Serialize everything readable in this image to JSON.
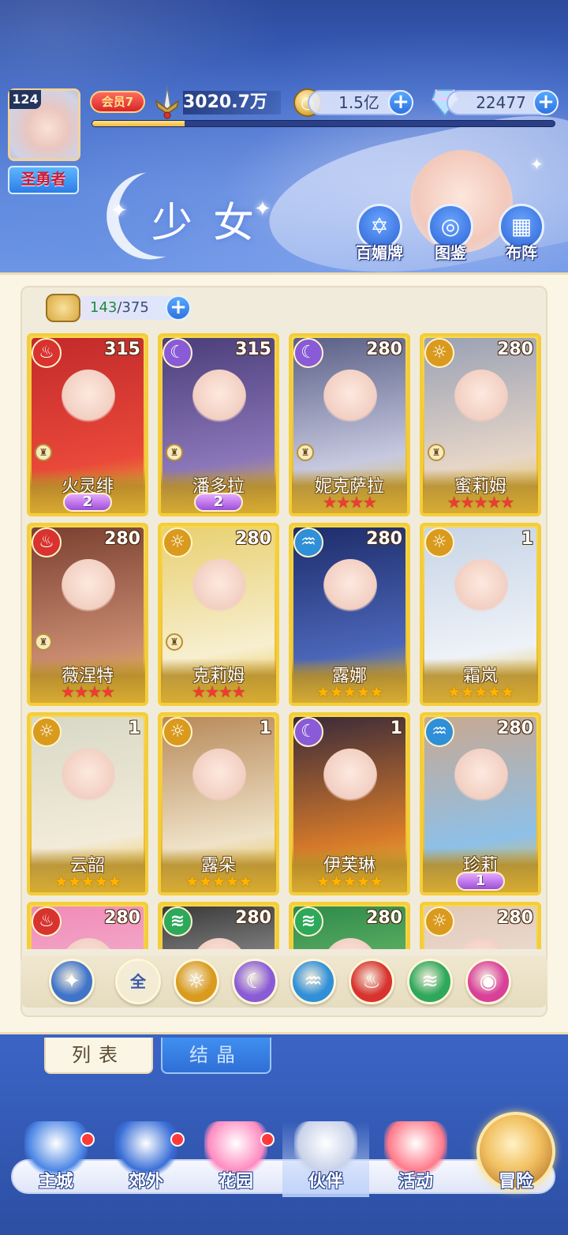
{
  "header": {
    "title": "少女",
    "player_level": "124",
    "rank": "圣勇者",
    "vip": "会员7",
    "power": "3020.7万",
    "exp_progress": 0.2,
    "gold": "1.5亿",
    "gems": "22477",
    "top_buttons": [
      {
        "label": "百媚牌",
        "icon": "card-deck-icon"
      },
      {
        "label": "图鉴",
        "icon": "book-icon"
      },
      {
        "label": "布阵",
        "icon": "grid-formation-icon"
      }
    ]
  },
  "collection": {
    "owned": "143",
    "total": "/375"
  },
  "cards": [
    {
      "name": "火灵绯",
      "level": "315",
      "element": "fire",
      "stars": "",
      "star_color": "",
      "wings": "2",
      "tower": true,
      "art": [
        "#c22a2a",
        "#e9483a"
      ]
    },
    {
      "name": "潘多拉",
      "level": "315",
      "element": "moon",
      "stars": "",
      "star_color": "",
      "wings": "2",
      "tower": true,
      "art": [
        "#4b3e7a",
        "#8a76b9"
      ]
    },
    {
      "name": "妮克萨拉",
      "level": "280",
      "element": "moon",
      "stars": "★★★★",
      "star_color": "red",
      "wings": "",
      "tower": true,
      "art": [
        "#5a5f86",
        "#c7c9e0"
      ]
    },
    {
      "name": "蜜莉姆",
      "level": "280",
      "element": "sun",
      "stars": "★★★★★",
      "star_color": "red",
      "wings": "",
      "tower": true,
      "art": [
        "#9aa1b4",
        "#e6d6c8"
      ]
    },
    {
      "name": "薇涅特",
      "level": "280",
      "element": "fire",
      "stars": "★★★★",
      "star_color": "red",
      "wings": "",
      "tower": true,
      "art": [
        "#7a4030",
        "#c88a70"
      ]
    },
    {
      "name": "克莉姆",
      "level": "280",
      "element": "sun",
      "stars": "★★★★",
      "star_color": "red",
      "wings": "",
      "tower": true,
      "art": [
        "#e8d070",
        "#f7efd0"
      ]
    },
    {
      "name": "露娜",
      "level": "280",
      "element": "water",
      "stars": "★★★★★",
      "star_color": "gold",
      "wings": "",
      "tower": false,
      "art": [
        "#1e2c6a",
        "#4b66b8"
      ]
    },
    {
      "name": "霜岚",
      "level": "1",
      "element": "sun",
      "stars": "★★★★★",
      "star_color": "gold",
      "wings": "",
      "tower": false,
      "art": [
        "#c7d4e6",
        "#eef2f8"
      ]
    },
    {
      "name": "云韶",
      "level": "1",
      "element": "sun",
      "stars": "★★★★★",
      "star_color": "gold",
      "wings": "",
      "tower": false,
      "art": [
        "#d8d8c6",
        "#f3ebd9"
      ]
    },
    {
      "name": "露朵",
      "level": "1",
      "element": "sun",
      "stars": "★★★★★",
      "star_color": "gold",
      "wings": "",
      "tower": false,
      "art": [
        "#b88a5a",
        "#efe2c8"
      ]
    },
    {
      "name": "伊芙琳",
      "level": "1",
      "element": "moon",
      "stars": "★★★★★",
      "star_color": "gold",
      "wings": "",
      "tower": false,
      "art": [
        "#3a2a3a",
        "#d67a2a"
      ]
    },
    {
      "name": "珍莉",
      "level": "280",
      "element": "water",
      "stars": "",
      "star_color": "",
      "wings": "1",
      "tower": false,
      "art": [
        "#c9a890",
        "#8ec0e8"
      ]
    },
    {
      "name": "",
      "level": "280",
      "element": "fire",
      "stars": "",
      "star_color": "",
      "wings": "",
      "tower": false,
      "art": [
        "#f08bb8",
        "#f6c2d8"
      ]
    },
    {
      "name": "",
      "level": "280",
      "element": "wind",
      "stars": "",
      "star_color": "",
      "wings": "",
      "tower": false,
      "art": [
        "#3a3a3a",
        "#c8c8c8"
      ]
    },
    {
      "name": "",
      "level": "280",
      "element": "wind",
      "stars": "",
      "star_color": "",
      "wings": "",
      "tower": false,
      "art": [
        "#2d8a4a",
        "#8ad07a"
      ]
    },
    {
      "name": "",
      "level": "280",
      "element": "sun",
      "stars": "",
      "star_color": "",
      "wings": "",
      "tower": false,
      "art": [
        "#e0c8b8",
        "#f6ece4"
      ]
    }
  ],
  "element_colors": {
    "fire": "#d8332e",
    "moon": "#8a5bd6",
    "sun": "#d99a1d",
    "water": "#2f8fd8",
    "wind": "#2ea85a"
  },
  "element_glyphs": {
    "fire": "♨",
    "moon": "☾",
    "sun": "☼",
    "water": "♒",
    "wind": "≋"
  },
  "filters": [
    {
      "name": "sort-toggle",
      "glyph": "✦",
      "color": "#3f74c9"
    },
    {
      "name": "filter-all",
      "glyph": "全",
      "color": "#f3ebd4",
      "text_color": "#3a5aa8"
    },
    {
      "name": "filter-sun",
      "glyph": "☼",
      "color": "#d99a1d"
    },
    {
      "name": "filter-moon",
      "glyph": "☾",
      "color": "#8a5bd6"
    },
    {
      "name": "filter-water",
      "glyph": "♒",
      "color": "#2f8fd8"
    },
    {
      "name": "filter-fire",
      "glyph": "♨",
      "color": "#d8332e"
    },
    {
      "name": "filter-wind",
      "glyph": "≋",
      "color": "#2ea85a"
    },
    {
      "name": "filter-dark",
      "glyph": "◉",
      "color": "#d9409a"
    }
  ],
  "tabs": {
    "list": "列表",
    "crystal": "结晶"
  },
  "nav": [
    {
      "label": "主城",
      "icon": "castle-icon",
      "dot": true
    },
    {
      "label": "郊外",
      "icon": "gate-icon",
      "dot": true
    },
    {
      "label": "花园",
      "icon": "hearts-icon",
      "dot": true
    },
    {
      "label": "伙伴",
      "icon": "partner-icon",
      "dot": false,
      "active": true
    },
    {
      "label": "活动",
      "icon": "gift-icon",
      "dot": false
    },
    {
      "label": "冒险",
      "icon": "compass-icon",
      "dot": false
    }
  ]
}
